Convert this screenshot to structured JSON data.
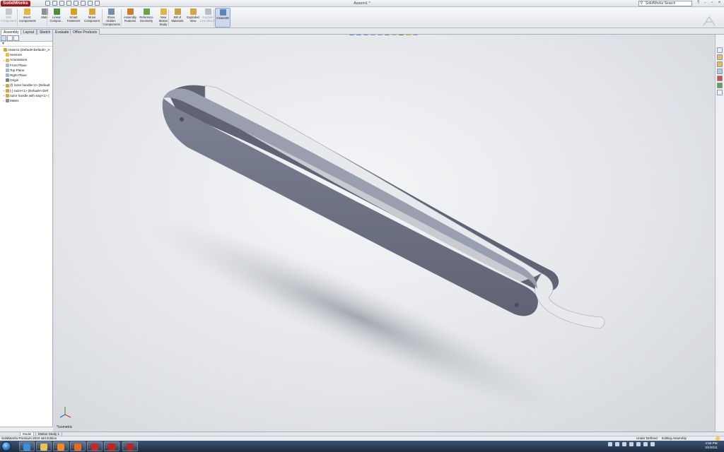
{
  "app": {
    "logo_text": "SolidWorks",
    "document_title": "Assem1 *",
    "search_placeholder": "SolidWorks Search",
    "window_controls": [
      "?",
      "-",
      "▫",
      "×"
    ]
  },
  "ribbon": {
    "buttons": [
      {
        "label": "Edit Component",
        "icon": "edit-component-icon",
        "color": "#c8c8c8",
        "disabled": true
      },
      {
        "label": "Insert Components",
        "icon": "insert-components-icon",
        "color": "#e5b740"
      },
      {
        "label": "Mate",
        "icon": "mate-icon",
        "color": "#8a8f98"
      },
      {
        "label": "Linear Compon...",
        "icon": "linear-pattern-icon",
        "color": "#4d8f3b"
      },
      {
        "label": "Smart Fasteners",
        "icon": "smart-fasteners-icon",
        "color": "#d8a020"
      },
      {
        "label": "Move Component",
        "icon": "move-component-icon",
        "color": "#d9a63a"
      },
      {
        "label": "Show Hidden Components",
        "icon": "show-hidden-icon",
        "color": "#7a8fb0"
      },
      {
        "label": "Assembly Features",
        "icon": "assembly-features-icon",
        "color": "#cf7d2a"
      },
      {
        "label": "Reference Geometry",
        "icon": "reference-geometry-icon",
        "color": "#6ca34a"
      },
      {
        "label": "New Motion Study",
        "icon": "motion-study-icon",
        "color": "#e0b44a"
      },
      {
        "label": "Bill of Materials",
        "icon": "bom-icon",
        "color": "#c7a048"
      },
      {
        "label": "Exploded View",
        "icon": "exploded-view-icon",
        "color": "#d4a64a"
      },
      {
        "label": "Explode Line Sketch",
        "icon": "explode-line-icon",
        "color": "#b9bec6",
        "disabled": true
      },
      {
        "label": "Instant3D",
        "icon": "instant3d-icon",
        "color": "#5b83c0",
        "active": true
      }
    ]
  },
  "command_tabs": [
    "Assembly",
    "Layout",
    "Sketch",
    "Evaluate",
    "Office Products"
  ],
  "feature_tree": {
    "items": [
      {
        "label": "Assem1  (Default<Default>_A",
        "icon": "assembly-icon",
        "color": "#d7a63a",
        "indent": 0,
        "expander": ""
      },
      {
        "label": "Sensors",
        "icon": "sensors-icon",
        "color": "#e2c046",
        "indent": 1,
        "expander": ""
      },
      {
        "label": "Annotations",
        "icon": "annotations-icon",
        "color": "#e2b83f",
        "indent": 1,
        "expander": "+"
      },
      {
        "label": "Front Plane",
        "icon": "plane-icon",
        "color": "#9fb6d4",
        "indent": 1,
        "expander": ""
      },
      {
        "label": "Top Plane",
        "icon": "plane-icon",
        "color": "#9fb6d4",
        "indent": 1,
        "expander": ""
      },
      {
        "label": "Right Plane",
        "icon": "plane-icon",
        "color": "#9fb6d4",
        "indent": 1,
        "expander": ""
      },
      {
        "label": "Origin",
        "icon": "origin-icon",
        "color": "#7a7f88",
        "indent": 1,
        "expander": ""
      },
      {
        "label": "(f) razor handle<1> (Default",
        "icon": "part-icon",
        "color": "#d1a63c",
        "indent": 1,
        "expander": "+"
      },
      {
        "label": "(-) razor<1> (Default<<Def",
        "icon": "part-icon",
        "color": "#d1a63c",
        "indent": 1,
        "expander": "+"
      },
      {
        "label": "razor handle with stop<1> (",
        "icon": "part-icon",
        "color": "#d1a63c",
        "indent": 1,
        "expander": "+"
      },
      {
        "label": "Mates",
        "icon": "mates-icon",
        "color": "#8a8f98",
        "indent": 1,
        "expander": "+"
      }
    ]
  },
  "viewport": {
    "view_label": "*Isometric",
    "hud_icons": [
      "zoom-to-fit-icon",
      "zoom-area-icon",
      "previous-view-icon",
      "section-view-icon",
      "view-orientation-icon",
      "display-style-icon",
      "hide-show-icon",
      "edit-appearance-icon",
      "apply-scene-icon",
      "view-settings-icon"
    ],
    "model_colors": {
      "handle": "#7d8294",
      "handle_dark": "#5f6374",
      "handle_top": "#9a9fb0",
      "blade": "#e8e9ec",
      "blade_shade": "#c9cbd0"
    }
  },
  "model_tabs": [
    "Model",
    "Motion Study 1"
  ],
  "status": {
    "left": "SolidWorks Premium 2010 x64 Edition",
    "defined": "Under Defined",
    "mode": "Editing Assembly"
  },
  "taskbar": {
    "apps": [
      {
        "name": "ie-icon",
        "color": "#3a8de0"
      },
      {
        "name": "explorer-icon",
        "color": "#e9c25a"
      },
      {
        "name": "media-player-icon",
        "color": "#f08a24"
      },
      {
        "name": "firefox-icon",
        "color": "#e66a1f"
      },
      {
        "name": "autocad-icon",
        "color": "#c42a2a"
      },
      {
        "name": "acrobat-icon",
        "color": "#c8201f"
      },
      {
        "name": "solidworks-icon",
        "color": "#b3262b"
      }
    ],
    "clock_time": "4:55 PM",
    "clock_date": "3/4/2011"
  }
}
